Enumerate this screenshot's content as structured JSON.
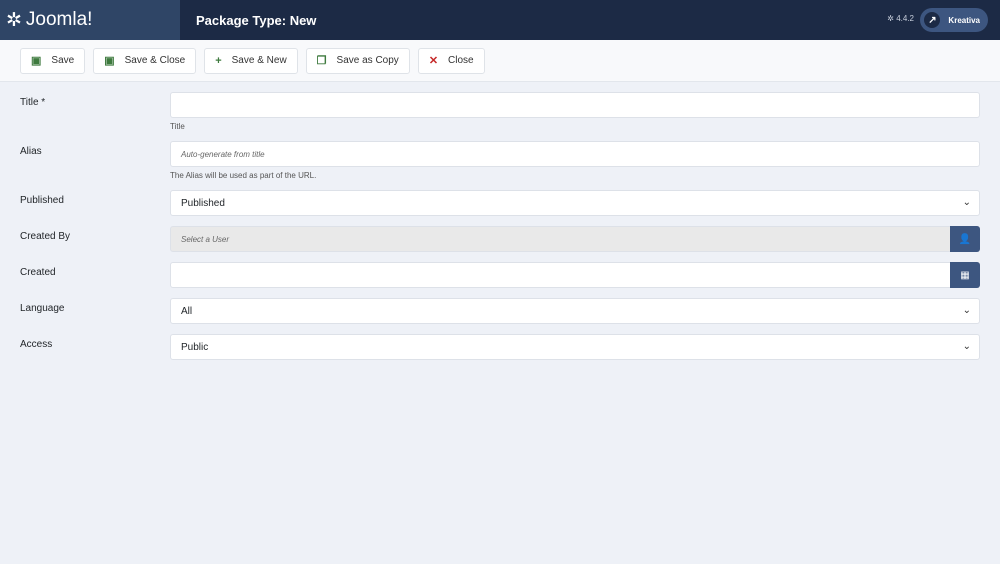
{
  "header": {
    "brand": "Joomla!",
    "title": "Package Type: New",
    "version": "4.4.2",
    "user": "Kreativa"
  },
  "toolbar": {
    "save": "Save",
    "save_close": "Save & Close",
    "save_new": "Save & New",
    "save_copy": "Save as Copy",
    "close": "Close"
  },
  "form": {
    "title_label": "Title *",
    "title_value": "",
    "title_help": "Title",
    "alias_label": "Alias",
    "alias_placeholder": "Auto-generate from title",
    "alias_help": "The Alias will be used as part of the URL.",
    "published_label": "Published",
    "published_value": "Published",
    "created_by_label": "Created By",
    "created_by_placeholder": "Select a User",
    "created_label": "Created",
    "created_value": "",
    "language_label": "Language",
    "language_value": "All",
    "access_label": "Access",
    "access_value": "Public"
  }
}
